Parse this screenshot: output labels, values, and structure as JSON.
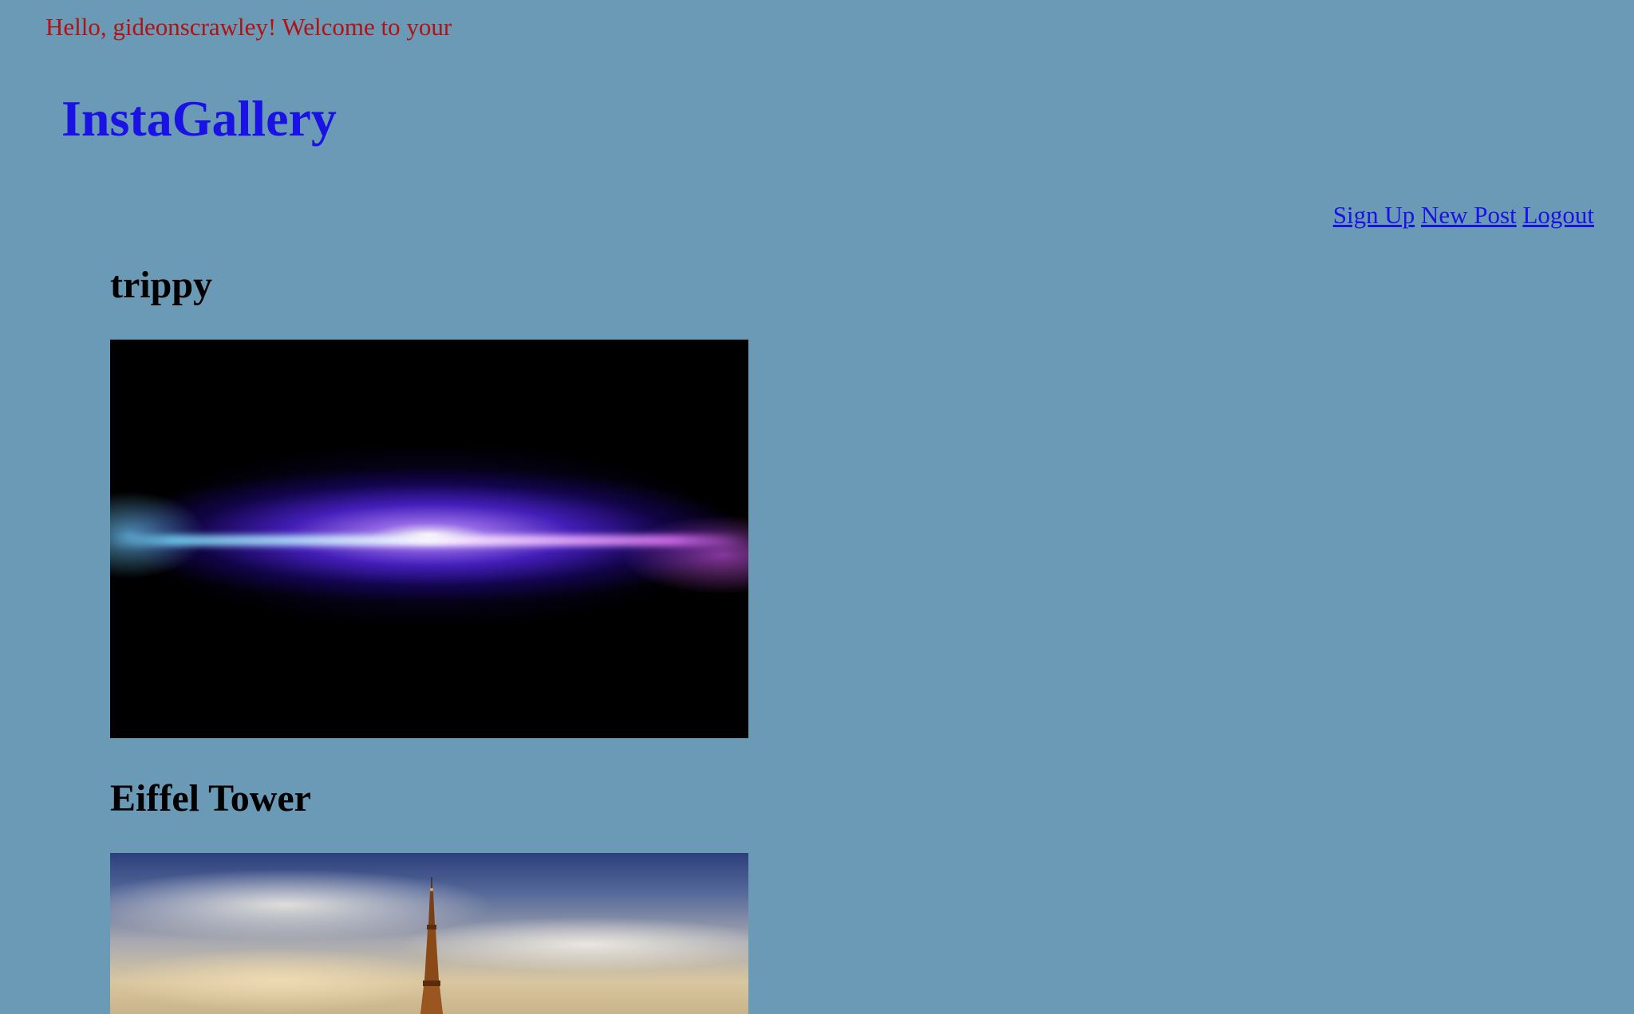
{
  "header": {
    "greeting": "Hello, gideonscrawley! Welcome to your",
    "site_title": "InstaGallery"
  },
  "nav": {
    "sign_up": "Sign Up",
    "new_post": "New Post",
    "logout": "Logout"
  },
  "posts": [
    {
      "title": "trippy"
    },
    {
      "title": "Eiffel Tower"
    }
  ],
  "colors": {
    "background": "#6a9ab5",
    "greeting_text": "#b11212",
    "link": "#1a11e4"
  }
}
